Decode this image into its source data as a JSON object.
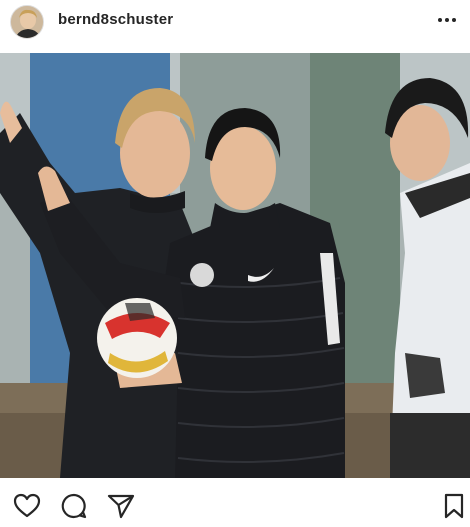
{
  "post": {
    "username": "bernd8schuster"
  },
  "icons": {
    "more": "more-options-icon",
    "like": "heart-icon",
    "comment": "comment-icon",
    "share": "send-icon",
    "save": "bookmark-icon"
  },
  "colors": {
    "text": "#262626",
    "background": "#ffffff"
  }
}
